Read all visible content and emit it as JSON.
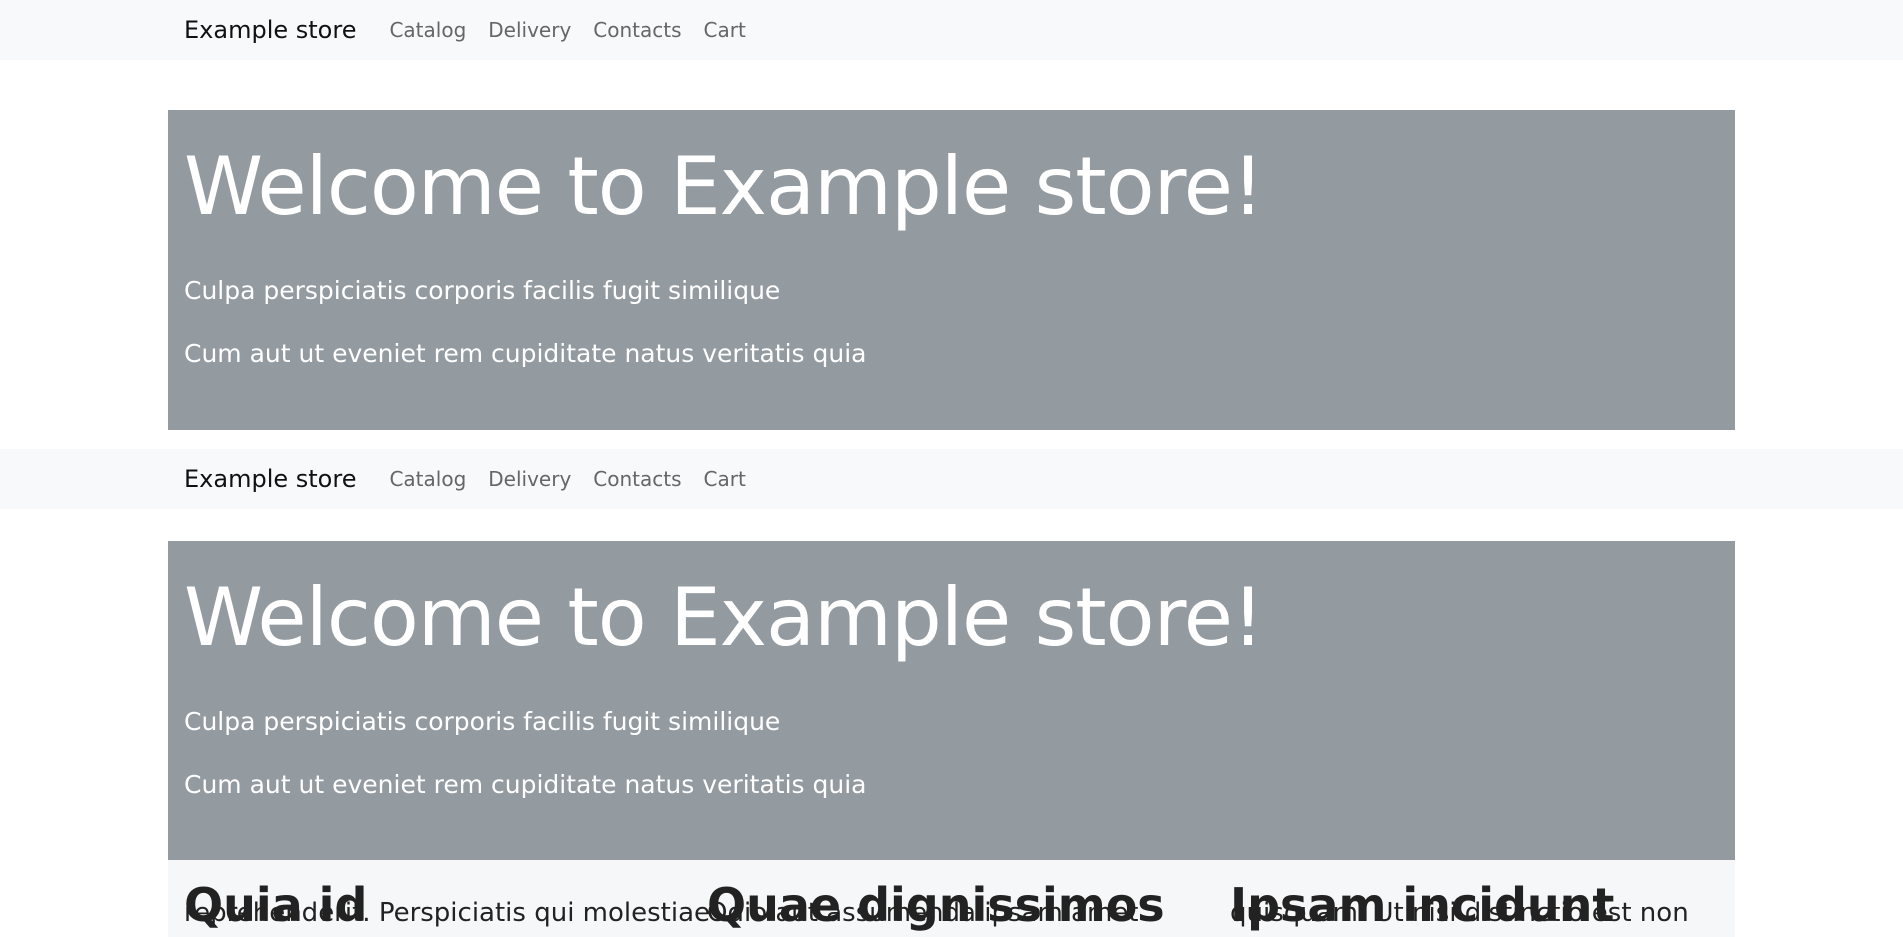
{
  "navbar": {
    "brand": "Example store",
    "links": [
      "Catalog",
      "Delivery",
      "Contacts",
      "Cart"
    ]
  },
  "hero": {
    "title": "Welcome to Example store!",
    "lines": [
      "Culpa perspiciatis corporis facilis fugit similique",
      "Cum aut ut eveniet rem cupiditate natus veritatis quia"
    ]
  },
  "cards": [
    {
      "heading": "Quia id",
      "text": "reprehenderit. Perspiciatis qui molestiae"
    },
    {
      "heading": "Quae dignissimos",
      "text": "Odio aut assumenda ipsam amet"
    },
    {
      "heading": "Ipsam incidunt",
      "text": "quisquam. Ut nisi distinctio est non"
    }
  ],
  "colors": {
    "navbar_bg": "#f8f9fa",
    "hero_bg": "#939aa0",
    "hero_text": "#ffffff"
  }
}
